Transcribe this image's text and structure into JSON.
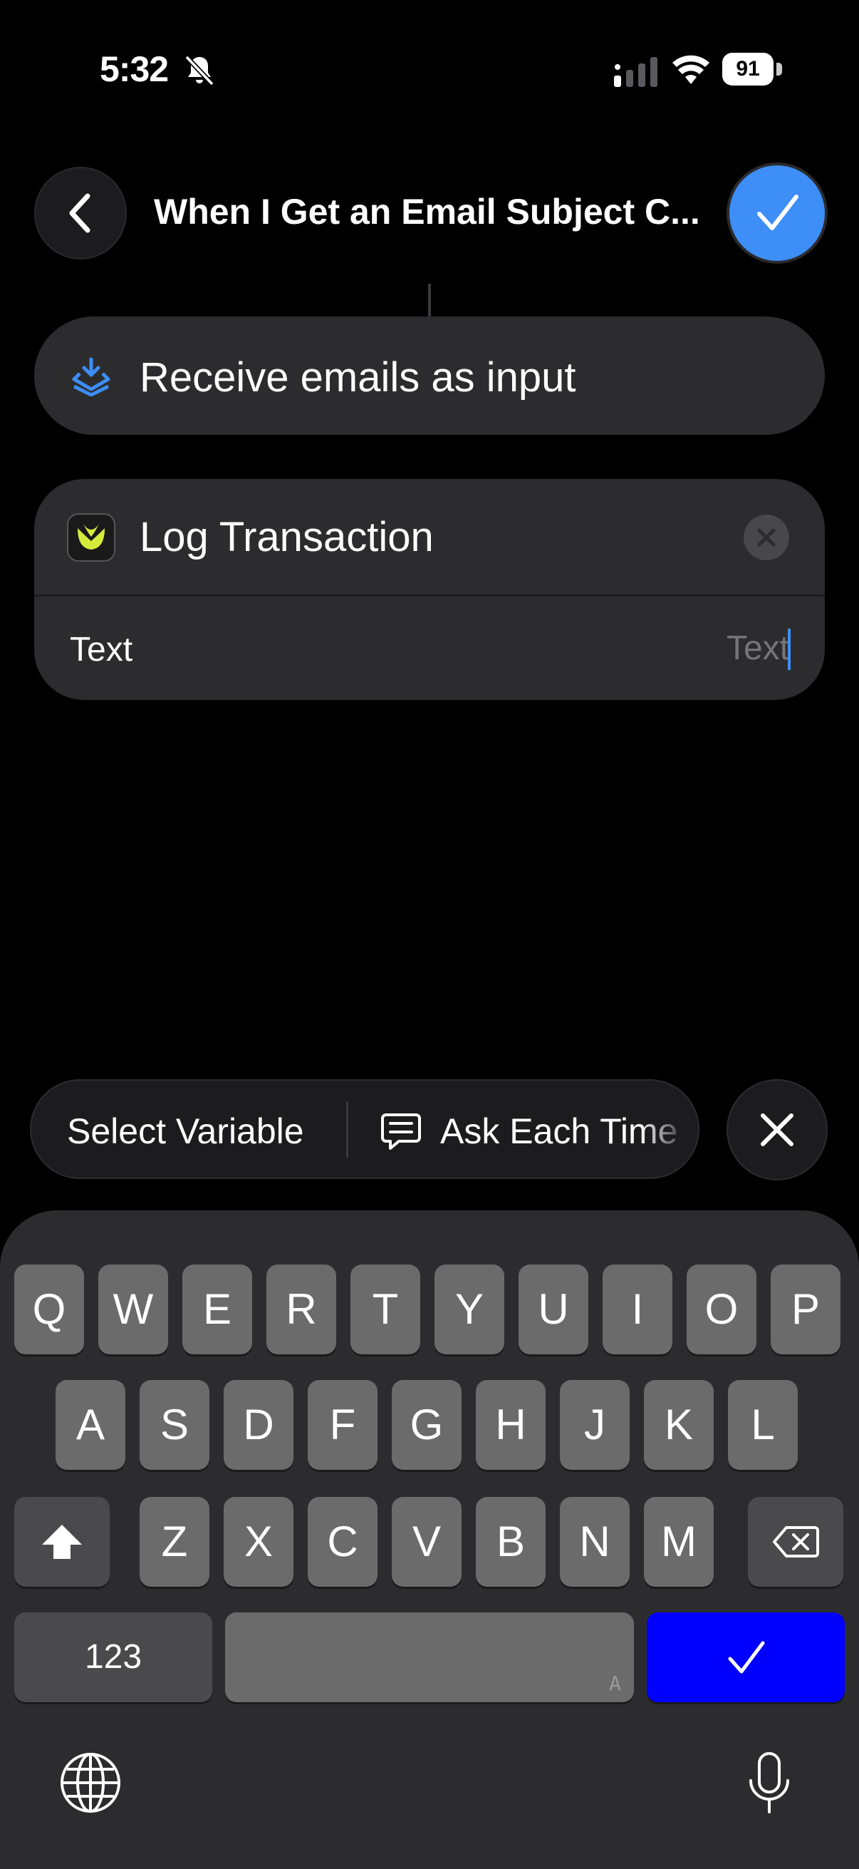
{
  "status_bar": {
    "time": "5:32",
    "battery_level": "91",
    "icons": [
      "bell-slash-icon",
      "cellular-signal-icon",
      "wifi-icon",
      "battery-icon"
    ]
  },
  "header": {
    "title": "When I Get an Email Subject C...",
    "back_icon": "chevron-left-icon",
    "done_icon": "checkmark-icon",
    "done_color": "#3d8ef6"
  },
  "actions": [
    {
      "label": "Receive emails as input",
      "icon": "receive-input-icon",
      "accent": "#3d8ef6"
    },
    {
      "label": "Log Transaction",
      "icon": "app-icon",
      "remove_icon": "close-icon",
      "parameter": {
        "label": "Text",
        "value": "",
        "placeholder": "Text"
      }
    }
  ],
  "variable_bar": {
    "select_variable_label": "Select Variable",
    "ask_each_time_label": "Ask Each Time",
    "ask_icon": "speech-bubble-icon",
    "close_icon": "close-icon"
  },
  "keyboard": {
    "row1": [
      "Q",
      "W",
      "E",
      "R",
      "T",
      "Y",
      "U",
      "I",
      "O",
      "P"
    ],
    "row2": [
      "A",
      "S",
      "D",
      "F",
      "G",
      "H",
      "J",
      "K",
      "L"
    ],
    "row3": [
      "Z",
      "X",
      "C",
      "V",
      "B",
      "N",
      "M"
    ],
    "numbers_label": "123",
    "space_hint": "A",
    "return_color": "#0000ff",
    "icons": [
      "shift-icon",
      "delete-icon",
      "globe-icon",
      "microphone-icon",
      "checkmark-icon"
    ]
  }
}
